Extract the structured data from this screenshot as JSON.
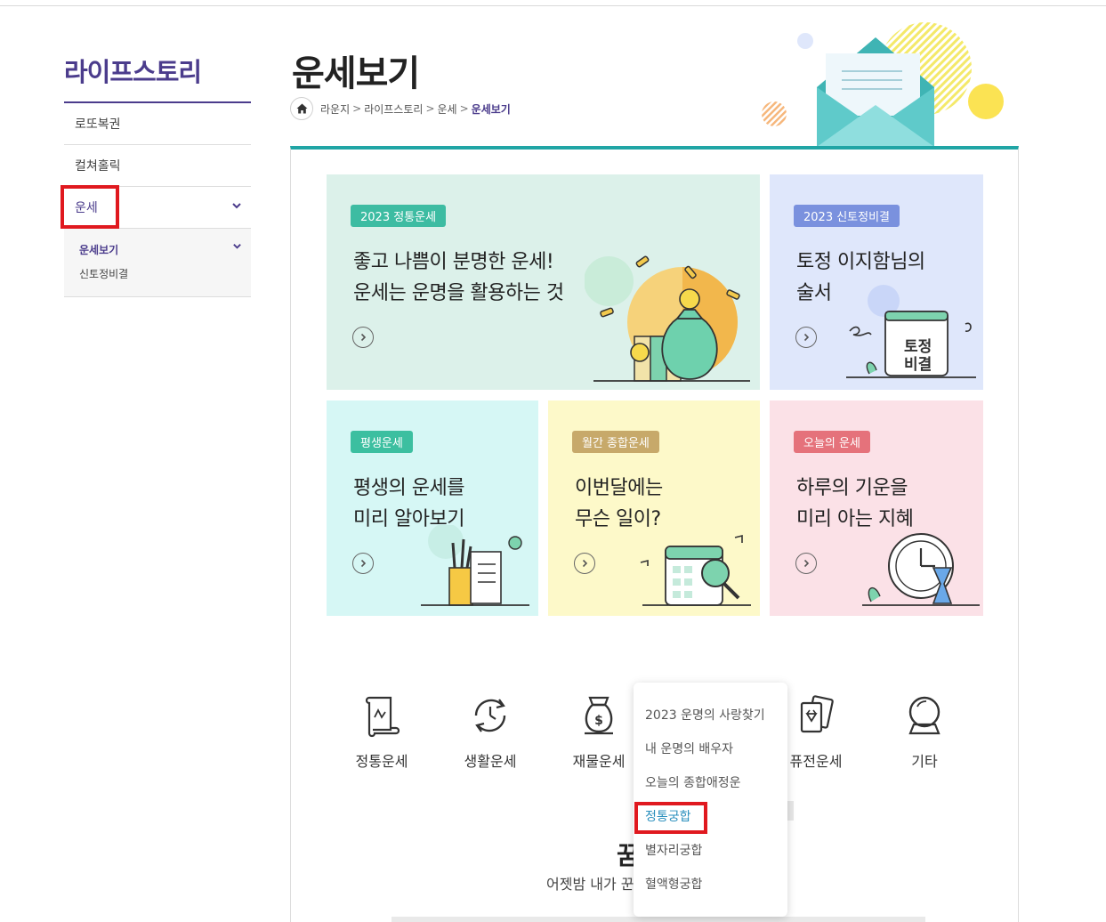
{
  "sidebar": {
    "title": "라이프스토리",
    "items": [
      {
        "label": "로또복권"
      },
      {
        "label": "컬쳐홀릭"
      },
      {
        "label": "운세"
      }
    ],
    "subitems": [
      {
        "label": "운세보기"
      },
      {
        "label": "신토정비결"
      }
    ]
  },
  "header": {
    "title": "운세보기",
    "breadcrumb": [
      "라운지",
      "라이프스토리",
      "운세",
      "운세보기"
    ],
    "separator": ">"
  },
  "cards": [
    {
      "tag": "2023 정통운세",
      "line1": "좋고 나쁨이 분명한 운세!",
      "line2": "운세는 운명을 활용하는 것",
      "bg": "#dcf1ea",
      "tag_color": "#3dbca2"
    },
    {
      "tag": "2023 신토정비결",
      "line1": "토정 이지함님의",
      "line2": "술서",
      "bg": "#dfe7fb",
      "tag_color": "#7a91de",
      "art_text_1": "토정",
      "art_text_2": "비결"
    },
    {
      "tag": "평생운세",
      "line1": "평생의 운세를",
      "line2": "미리 알아보기",
      "bg": "#d6f7f5",
      "tag_color": "#3cbfa0"
    },
    {
      "tag": "월간 종합운세",
      "line1": "이번달에는",
      "line2": "무슨 일이?",
      "bg": "#fdf9c9",
      "tag_color": "#c7a96a"
    },
    {
      "tag": "오늘의 운세",
      "line1": "하루의 기운을",
      "line2": "미리 아는 지혜",
      "bg": "#fbe1e7",
      "tag_color": "#e5727b"
    }
  ],
  "icon_menu": [
    {
      "label": "정통운세",
      "icon": "scroll-icon"
    },
    {
      "label": "생활운세",
      "icon": "cycle-clock-icon"
    },
    {
      "label": "재물운세",
      "icon": "money-bag-icon"
    },
    {
      "label": "",
      "icon": "heart-icon"
    },
    {
      "label": "퓨전운세",
      "icon": "cards-icon"
    },
    {
      "label": "기타",
      "icon": "crystal-ball-icon"
    }
  ],
  "dropdown": {
    "items": [
      {
        "label": "2023 운명의 사랑찾기"
      },
      {
        "label": "내 운명의 배우자"
      },
      {
        "label": "오늘의 종합애정운"
      },
      {
        "label": "정통궁합"
      },
      {
        "label": "별자리궁합"
      },
      {
        "label": "혈액형궁합"
      }
    ]
  },
  "bottom": {
    "headline_fragment": "꿈",
    "sub_fragment": "어젯밤 내가 꾼"
  },
  "colors": {
    "brand_purple": "#4b3c8c",
    "accent_teal": "#20a5a5",
    "highlight_blue": "#2a8fbd",
    "annotation_red": "#e0191f"
  }
}
